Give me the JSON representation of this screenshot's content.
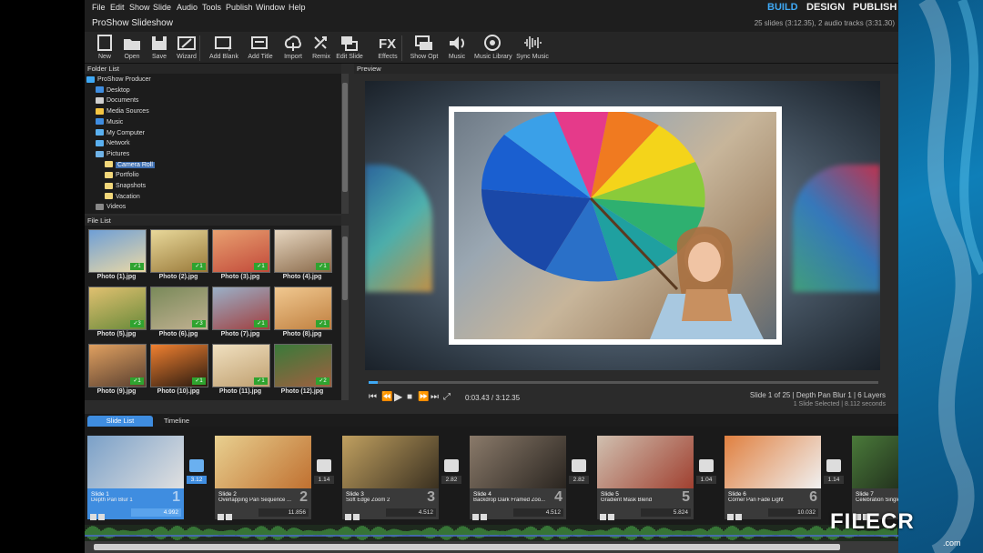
{
  "menu": [
    "File",
    "Edit",
    "Show",
    "Slide",
    "Audio",
    "Tools",
    "Publish",
    "Window",
    "Help"
  ],
  "modes": [
    {
      "label": "BUILD",
      "active": true
    },
    {
      "label": "DESIGN",
      "active": false
    },
    {
      "label": "PUBLISH",
      "active": false
    }
  ],
  "window": {
    "title": "ProShow Slideshow",
    "summary": "25 slides (3:12.35), 2 audio tracks (3:31.30)"
  },
  "toolbar": [
    {
      "label": "New",
      "icon": "new-icon"
    },
    {
      "label": "Open",
      "icon": "open-folder-icon"
    },
    {
      "label": "Save",
      "icon": "save-icon"
    },
    {
      "label": "Wizard",
      "icon": "wizard-icon"
    },
    {
      "label": "Add Blank",
      "icon": "add-blank-icon"
    },
    {
      "label": "Add Title",
      "icon": "add-title-icon"
    },
    {
      "label": "Import",
      "icon": "import-cloud-icon"
    },
    {
      "label": "Remix",
      "icon": "remix-icon"
    },
    {
      "label": "Edit Slide",
      "icon": "edit-slide-icon"
    },
    {
      "label": "Effects",
      "icon": "fx-icon"
    },
    {
      "label": "Show Opt",
      "icon": "show-options-icon"
    },
    {
      "label": "Music",
      "icon": "speaker-icon"
    },
    {
      "label": "Music Library",
      "icon": "music-library-icon"
    },
    {
      "label": "Sync Music",
      "icon": "sync-music-icon"
    }
  ],
  "folder_list": {
    "title": "Folder List",
    "items": [
      {
        "label": "ProShow Producer",
        "indent": 0,
        "color": "#3fa9f5",
        "selected": false
      },
      {
        "label": "Desktop",
        "indent": 1,
        "color": "#3f8de0",
        "selected": false
      },
      {
        "label": "Documents",
        "indent": 1,
        "color": "#cfcfcf",
        "selected": false
      },
      {
        "label": "Media Sources",
        "indent": 1,
        "color": "#f5c542",
        "selected": false
      },
      {
        "label": "Music",
        "indent": 1,
        "color": "#3f8de0",
        "selected": false
      },
      {
        "label": "My Computer",
        "indent": 1,
        "color": "#5ab0f0",
        "selected": false
      },
      {
        "label": "Network",
        "indent": 1,
        "color": "#5ab0f0",
        "selected": false
      },
      {
        "label": "Pictures",
        "indent": 1,
        "color": "#6fb3e8",
        "selected": false
      },
      {
        "label": "Camera Roll",
        "indent": 2,
        "color": "#f2d77a",
        "selected": true
      },
      {
        "label": "Portfolio",
        "indent": 2,
        "color": "#f2d77a",
        "selected": false
      },
      {
        "label": "Snapshots",
        "indent": 2,
        "color": "#f2d77a",
        "selected": false
      },
      {
        "label": "Vacation",
        "indent": 2,
        "color": "#f2d77a",
        "selected": false
      },
      {
        "label": "Videos",
        "indent": 1,
        "color": "#888888",
        "selected": false
      }
    ]
  },
  "file_list": {
    "title": "File List",
    "files": [
      {
        "name": "Photo (1).jpg",
        "badge": "1",
        "colors": [
          "#6f9fd6",
          "#e9d8a6"
        ]
      },
      {
        "name": "Photo (2).jpg",
        "badge": "1",
        "colors": [
          "#e8d89a",
          "#9a7a3a"
        ]
      },
      {
        "name": "Photo (3).jpg",
        "badge": "1",
        "colors": [
          "#e8a070",
          "#c24a3a"
        ]
      },
      {
        "name": "Photo (4).jpg",
        "badge": "1",
        "colors": [
          "#e6d6c0",
          "#8a6a4a"
        ]
      },
      {
        "name": "Photo (5).jpg",
        "badge": "3",
        "colors": [
          "#e0c070",
          "#6a8a3a"
        ]
      },
      {
        "name": "Photo (6).jpg",
        "badge": "3",
        "colors": [
          "#7a8a5a",
          "#c0b090"
        ]
      },
      {
        "name": "Photo (7).jpg",
        "badge": "1",
        "colors": [
          "#9ab0c8",
          "#a04040"
        ]
      },
      {
        "name": "Photo (8).jpg",
        "badge": "1",
        "colors": [
          "#f0c890",
          "#c08040"
        ]
      },
      {
        "name": "Photo (9).jpg",
        "badge": "1",
        "colors": [
          "#e0a060",
          "#5a4030"
        ]
      },
      {
        "name": "Photo (10).jpg",
        "badge": "1",
        "colors": [
          "#f08030",
          "#2a1a10"
        ]
      },
      {
        "name": "Photo (11).jpg",
        "badge": "1",
        "colors": [
          "#f0e0c0",
          "#c0a070"
        ]
      },
      {
        "name": "Photo (12).jpg",
        "badge": "2",
        "colors": [
          "#3a7a3a",
          "#a06040"
        ]
      }
    ]
  },
  "preview": {
    "title": "Preview",
    "time": "0:03.43 / 3:12.35",
    "progress": 0.018,
    "slide_info": "Slide 1 of 25  |  Depth Pan Blur 1  |  6 Layers",
    "selection_info": "1 Slide Selected  |  8.112 seconds"
  },
  "tabs": [
    {
      "label": "Slide List",
      "active": true
    },
    {
      "label": "Timeline",
      "active": false
    }
  ],
  "slides": [
    {
      "name": "Slide 1",
      "desc": "Depth Pan Blur 1",
      "num": "1",
      "duration": "4.992",
      "selected": true,
      "colors": [
        "#7aa0c8",
        "#e0e0e0"
      ]
    },
    {
      "name": "Slide 2",
      "desc": "Overlapping Pan Sequence ...",
      "num": "2",
      "duration": "11.856",
      "selected": false,
      "colors": [
        "#e8d090",
        "#c07030"
      ]
    },
    {
      "name": "Slide 3",
      "desc": "Soft Edge Zoom 2",
      "num": "3",
      "duration": "4.512",
      "selected": false,
      "colors": [
        "#c0a060",
        "#3a3020"
      ]
    },
    {
      "name": "Slide 4",
      "desc": "Backdrop Dark Framed Zoo...",
      "num": "4",
      "duration": "4.512",
      "selected": false,
      "colors": [
        "#8a7a6a",
        "#2a2520"
      ]
    },
    {
      "name": "Slide 5",
      "desc": "Gradient Mask Blend",
      "num": "5",
      "duration": "5.824",
      "selected": false,
      "colors": [
        "#d0c0b0",
        "#a04030"
      ]
    },
    {
      "name": "Slide 6",
      "desc": "Corner Pan Fade Light",
      "num": "6",
      "duration": "10.032",
      "selected": false,
      "colors": [
        "#e08040",
        "#f0f0f0"
      ]
    },
    {
      "name": "Slide 7",
      "desc": "Celebration Single",
      "num": "7",
      "duration": "",
      "selected": false,
      "colors": [
        "#4a7a3a",
        "#101010"
      ]
    }
  ],
  "transitions": [
    {
      "duration": "3.12",
      "selected": true
    },
    {
      "duration": "1.14",
      "selected": false
    },
    {
      "duration": "2.82",
      "selected": false
    },
    {
      "duration": "2.82",
      "selected": false
    },
    {
      "duration": "1.04",
      "selected": false
    },
    {
      "duration": "1.14",
      "selected": false
    }
  ],
  "watermark": {
    "text": "FILECR",
    "sub": ".com"
  }
}
